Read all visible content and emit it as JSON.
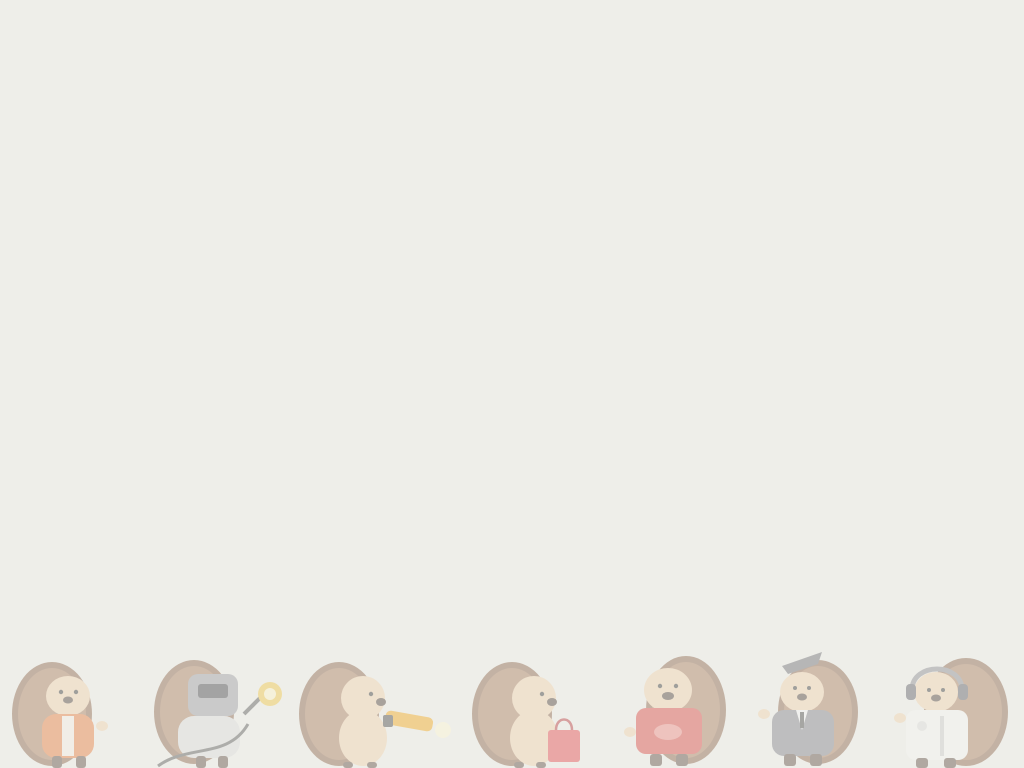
{
  "wallpaper": {
    "background_color": "#eeeee9",
    "mascots": [
      {
        "name": "hedgehog-orange-jacket",
        "accent": "#e87a3a"
      },
      {
        "name": "hedgehog-welder",
        "accent": "#f2c744"
      },
      {
        "name": "hedgehog-flashlight",
        "accent": "#f4a91a"
      },
      {
        "name": "hedgehog-shopping-bag",
        "accent": "#e5474b"
      },
      {
        "name": "hedgehog-red-shirt",
        "accent": "#d9443f"
      },
      {
        "name": "hedgehog-graduate-suit",
        "accent": "#7e7e86"
      },
      {
        "name": "hedgehog-headphones",
        "accent": "#8a8a90"
      }
    ]
  }
}
